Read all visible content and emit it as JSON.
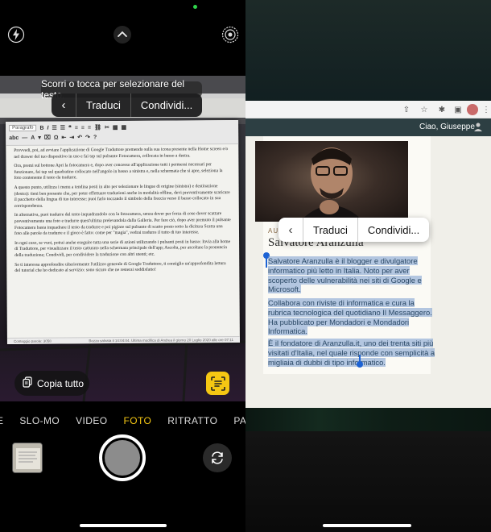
{
  "left": {
    "hint": "Scorri o tocca per selezionare del testo.",
    "context_menu": {
      "back_icon": "chevron-left-icon",
      "items": [
        "Traduci",
        "Condividi..."
      ]
    },
    "document": {
      "toolbar": {
        "style_select": "Paragrafo"
      },
      "paragraphs": [
        "Provvedi, poi, ad avviare l'applicazione di Google Traduttore premendo sulla sua icona presente nella Home screen e/o nel drawer del tuo dispositivo in uso e fai tap sul pulsante Fotocamera, collocata in basso a destra.",
        "Ora, premi sul bottone Apri la fotocamera e, dopo aver concesso all'applicazione tutti i permessi necessari per funzionare, fai tap sul quadratino collocato nell'angolo in basso a sinistra e, nella schermata che si apre, seleziona la foto contenente il testo da tradurre.",
        "A questo punto, utilizza i menu a tendina posti in alto per selezionare le lingue di origine (sinistra) e destinazione (destra): tieni ben presente che, per poter effettuare traduzioni anche in modalità offline, devi preventivamente scaricare il pacchetto della lingua di tuo interesse: puoi farlo toccando il simbolo della freccia verso il basso collocato in sua corrispondenza.",
        "In alternativa, puoi tradurre del testo inquadrandolo con la fotocamera, senza dover per forza di cose dover scattare preventivamente una foto e tradurre quest'ultima prelevandola dalla Galleria. Per fare ciò, dopo aver premuto il pulsante Fotocamera basta inquadrare il testo da tradurre e poi pigiare sul pulsante di scatto posto sotto la dicitura Scatta una foto alle parole da tradurre e il gioco è fatto: come per \"magia\", vedrai tradurre il tutto di tuo interesse.",
        "In ogni caso, se vuoi, potrai anche eseguire tutta una serie di azioni utilizzando i pulsanti posti in basso: Invia alla home di Traduttore, per visualizzare il testo catturato nella schermata principale dell'app; Ascolta, per ascoltare la pronuncia della traduzione; Condividi, per condividere la traduzione con altri utenti; etc.",
        "Se ti interessa approfondire ulteriormente l'utilizzo generale di Google Traduttore, ti consiglio un'approfondita lettura del tutorial che ho dedicato al servizio: sono sicuro che ne resterai soddisfatto!"
      ],
      "status_left": "Conteggio parole: 3058",
      "status_right": "Bozza salvata il 14:04:04. Ultima modifica di Andrea il giorno 20 Luglio 2020 alle ore 07:11"
    },
    "copy_all": {
      "icon": "copy-text-icon",
      "label": "Copia tutto"
    },
    "live_text_icon": "live-text-icon",
    "modes": [
      "E",
      "SLO-MO",
      "VIDEO",
      "FOTO",
      "RITRATTO",
      "PANORAMICA"
    ],
    "active_mode": "FOTO",
    "top_icons": [
      "flash-off-icon",
      "chevron-up-icon",
      "live-photo-icon"
    ]
  },
  "right": {
    "greeting": "Ciao, Giuseppe",
    "author_tag": "AUTORE",
    "author_name": "Salvatore Aranzulla",
    "context_menu": {
      "back_icon": "chevron-left-icon",
      "items": [
        "Traduci",
        "Condividi..."
      ]
    },
    "bio": [
      [
        "Salvatore Aranzulla è il blogger e divulgatore",
        "informatico più letto in Italia. Noto per aver",
        "scoperto delle vulnerabilità nei siti di Google e",
        "Microsoft."
      ],
      [
        "Collabora con riviste di informatica e cura la",
        "rubrica tecnologica del quotidiano Il Messaggero.",
        "Ha pubblicato per Mondadori e Mondadori",
        "Informatica."
      ],
      [
        "È il fondatore di Aranzulla.it, uno dei trenta siti più",
        "visitati d'Italia, nel quale risponde con semplicità a",
        "migliaia di dubbi di tipo informatico."
      ]
    ]
  },
  "colors": {
    "accent_yellow": "#f5c713",
    "selection_blue": "#1d63d4",
    "highlight": "#8fa9cf"
  }
}
